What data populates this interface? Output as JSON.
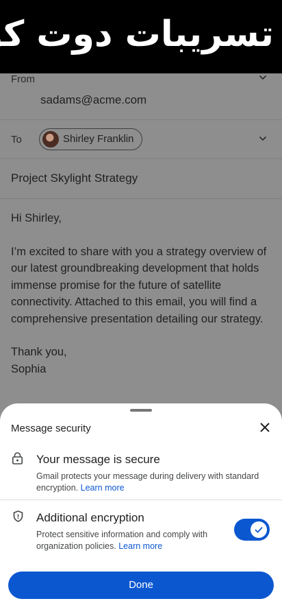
{
  "banner": {
    "text": "تسريبات دوت كوم | تسريبات دوت كوم"
  },
  "compose": {
    "from_label": "From",
    "from_value": "sadams@acme.com",
    "to_label": "To",
    "to_recipient": "Shirley Franklin",
    "subject": "Project Skylight Strategy",
    "body": {
      "greeting": "Hi Shirley,",
      "paragraph": "I’m excited to share with you a strategy overview of our latest groundbreaking development that holds immense promise for the future of satellite connectivity. Attached to this email, you will find a comprehensive presentation detailing our strategy.",
      "signoff": "Thank you,",
      "signature": "Sophia"
    }
  },
  "sheet": {
    "title": "Message security",
    "secure": {
      "title": "Your message is secure",
      "description": "Gmail protects your message during delivery with standard encryption.",
      "link": "Learn more"
    },
    "encryption": {
      "title": "Additional encryption",
      "description": "Protect sensitive information and comply with organization policies.",
      "link": "Learn more",
      "enabled": true
    },
    "done_label": "Done"
  },
  "colors": {
    "accent": "#0b57d0",
    "banner_bg": "#000000",
    "scrim": "#8e8e8e"
  },
  "icons": [
    "chevron-down-icon",
    "lock-icon",
    "shield-icon",
    "close-icon",
    "check-icon"
  ]
}
